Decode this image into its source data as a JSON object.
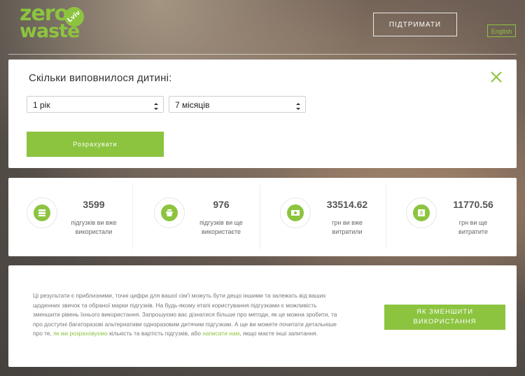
{
  "header": {
    "logo": {
      "zero": "zero",
      "waste": "waste",
      "lviv": "Lviv"
    },
    "support_label": "ПІДТРИМАТИ",
    "language_label": "English"
  },
  "calculator": {
    "title": "Скільки виповнилося дитині:",
    "years_value": "1 рік",
    "months_value": "7 місяців",
    "calculate_label": "Розрахувати"
  },
  "stats": [
    {
      "value": "3599",
      "label_line1": "підгузків ви вже",
      "label_line2": "використали",
      "icon": "diaper-stack-icon"
    },
    {
      "value": "976",
      "label_line1": "підгузків ви ще",
      "label_line2": "використаєте",
      "icon": "diaper-basket-icon"
    },
    {
      "value": "33514.62",
      "label_line1": "грн ви вже",
      "label_line2": "витратили",
      "icon": "money-spent-icon"
    },
    {
      "value": "11770.56",
      "label_line1": "грн ви ще",
      "label_line2": "витратите",
      "icon": "money-future-icon"
    }
  ],
  "info": {
    "text_part1": "Ці результати є приблизними, точні цифри для вашої сім'ї можуть бути дещо іншими та залежать від ваших щоденних звичок та обраної марки підгузків. На будь-якому етапі користування підгузками є можливість зменшити рівень їхнього використання. Запрошуємо вас дізнатися більше про методи, як це можна зробити, та про доступні багаторазові альтернативи одноразовим дитячим підгузкам. А ще ви можете почитати детальніше про те,",
    "link1": "як ми розраховуємо",
    "text_part2": "кількість та вартість підгузків, або",
    "link2": "написати нам",
    "text_part3": ", якщо маєте інші запитання.",
    "reduce_label_line1": "ЯК ЗМЕНШИТИ",
    "reduce_label_line2": "ВИКОРИСТАННЯ"
  },
  "colors": {
    "accent": "#8cc43f"
  }
}
